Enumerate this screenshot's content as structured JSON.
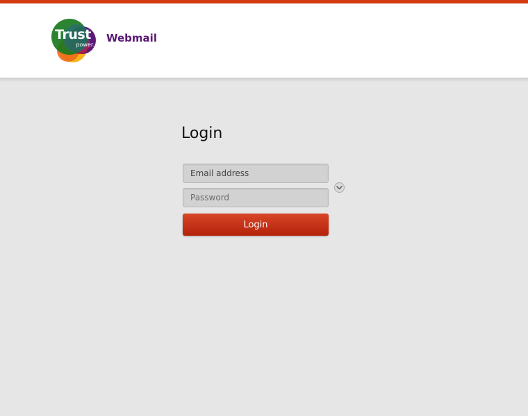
{
  "colors": {
    "top_bar": "#d23a11",
    "header_bg": "#ffffff",
    "page_bg": "#e6e6e6",
    "brand_purple": "#5b1a74",
    "button_red": "#c3300f"
  },
  "header": {
    "logo": {
      "text": "Trust",
      "subtext": "power."
    },
    "title": "Webmail"
  },
  "login": {
    "heading": "Login",
    "email": {
      "placeholder": "Email address",
      "value": ""
    },
    "password": {
      "placeholder": "Password",
      "value": ""
    },
    "options_icon": "chevron-down-icon",
    "button_label": "Login"
  }
}
